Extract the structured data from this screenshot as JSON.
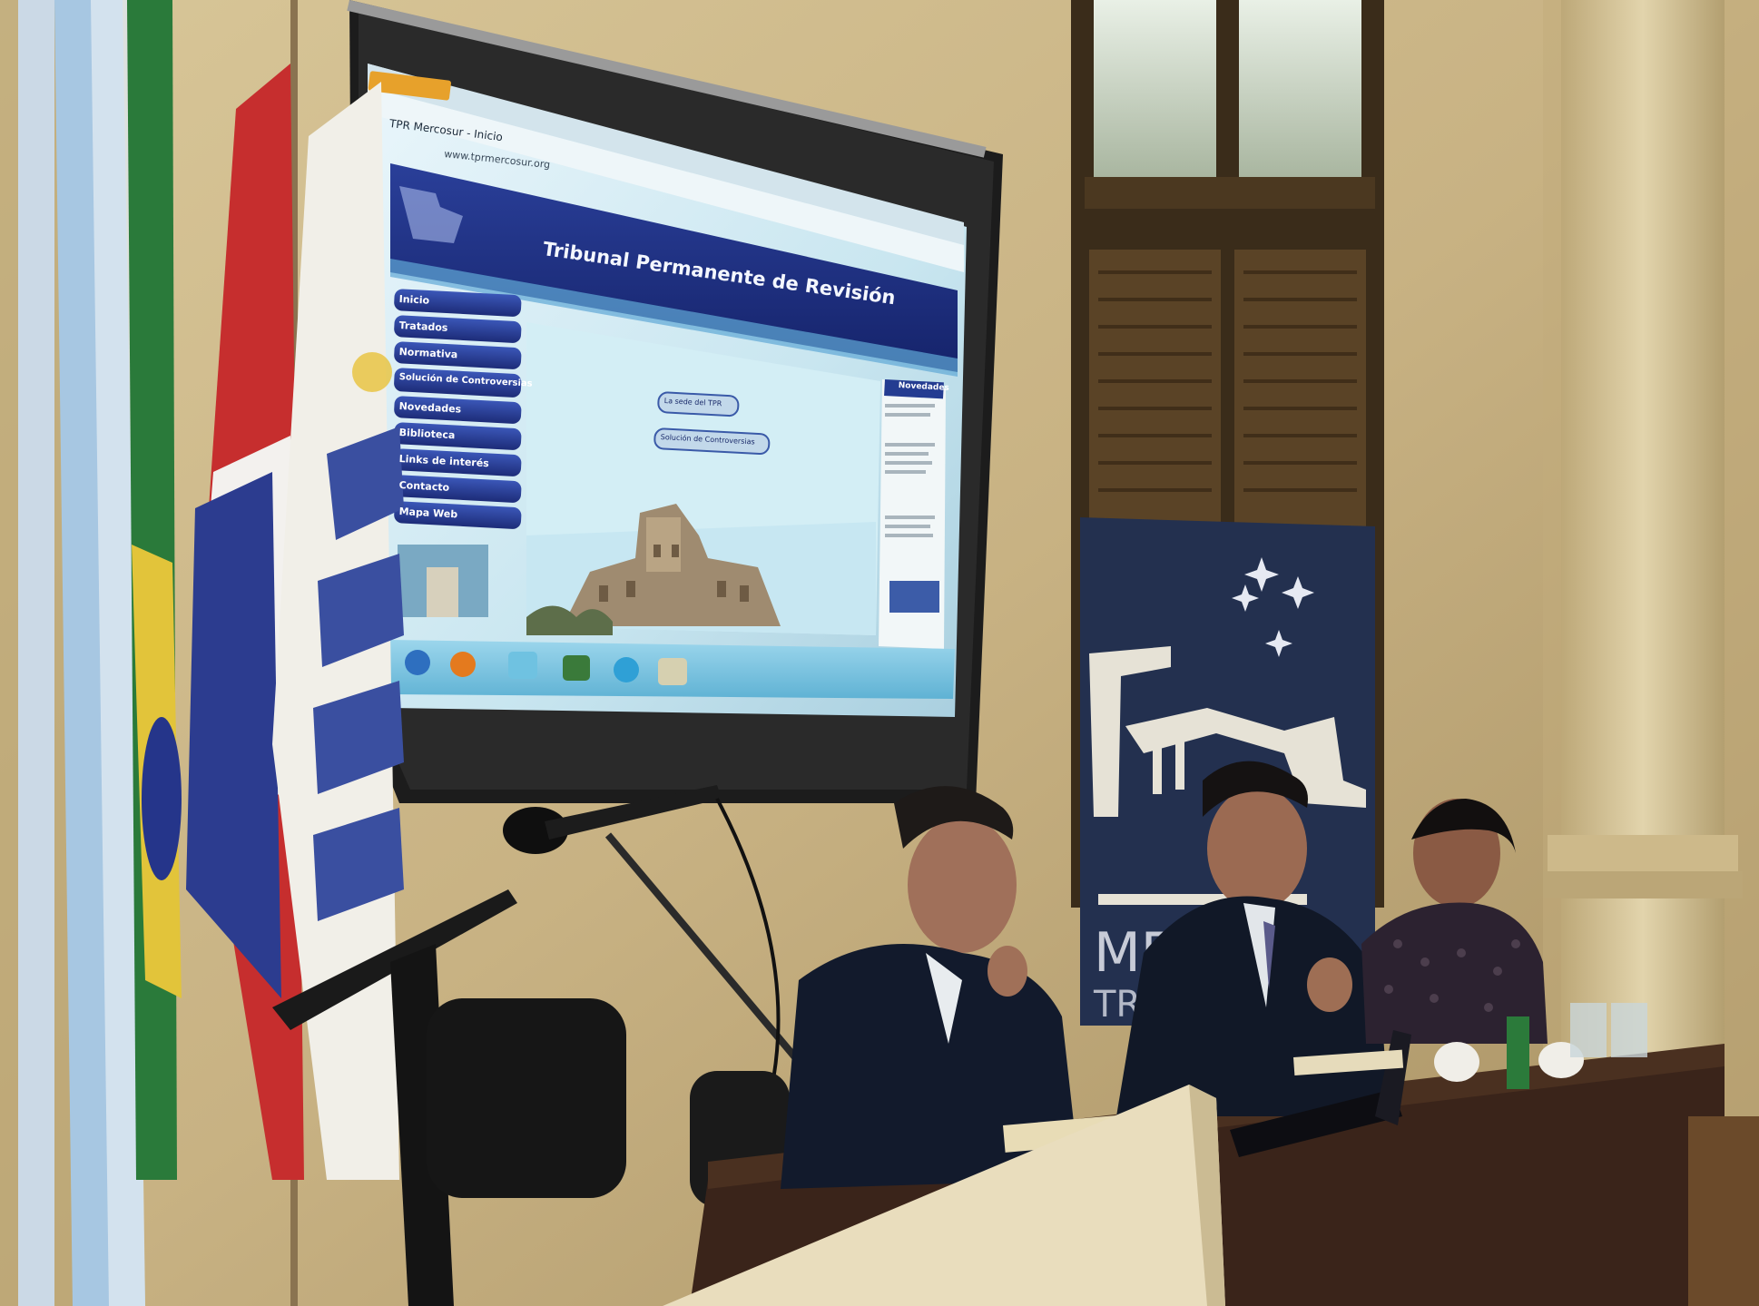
{
  "screen": {
    "browser_tab_title": "TPR Mercosur - Inicio",
    "browser_url": "www.tprmercosur.org",
    "site_title": "Tribunal Permanente de Revisión",
    "menu_items": [
      {
        "label": "Inicio"
      },
      {
        "label": "Tratados"
      },
      {
        "label": "Normativa"
      },
      {
        "label": "Solución de Controversias"
      },
      {
        "label": "Novedades"
      },
      {
        "label": "Biblioteca"
      },
      {
        "label": "Links de interés"
      },
      {
        "label": "Contacto"
      },
      {
        "label": "Mapa Web"
      }
    ],
    "content_buttons": [
      {
        "label": "La sede del TPR"
      },
      {
        "label": "Solución de Controversias"
      }
    ],
    "sidebar_heading": "Novedades"
  },
  "colors": {
    "wall": "#c9b485",
    "screen_glow": "#cfe8f2",
    "site_header": "#1d2f7e",
    "banner": "#23304f",
    "suit": "#121a2c",
    "table": "#3a241a"
  }
}
